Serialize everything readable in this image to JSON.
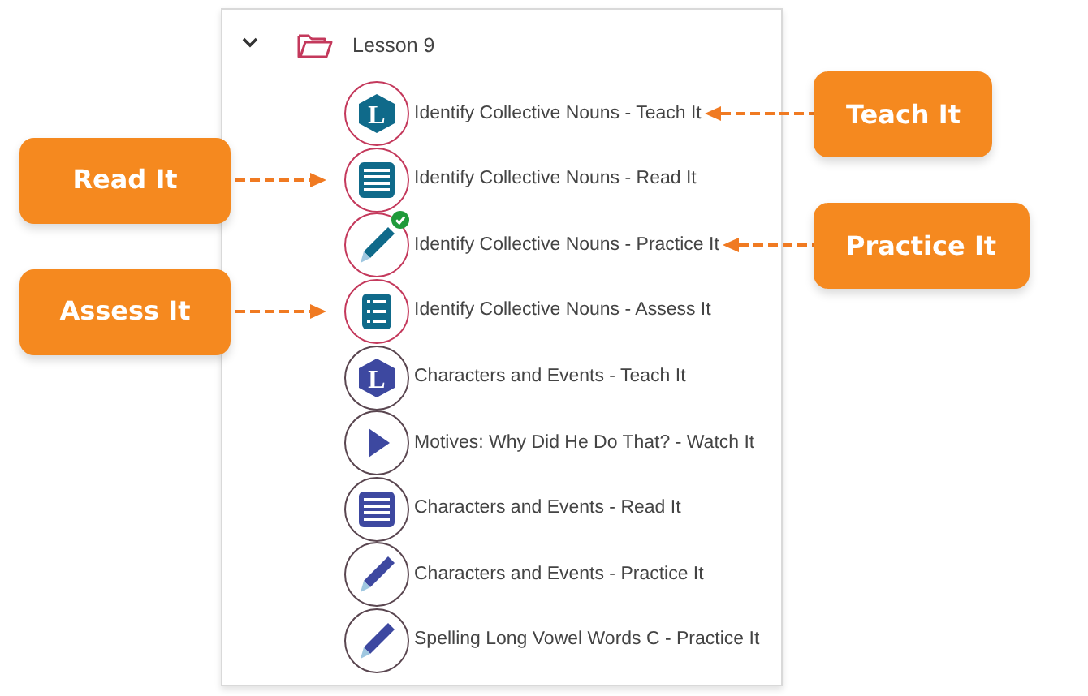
{
  "lesson": {
    "title": "Lesson 9",
    "expanded": true
  },
  "items": [
    {
      "title": "Identify Collective Nouns - Teach It",
      "kind": "teach",
      "letter": "L",
      "highlighted": true,
      "completed": false,
      "callout": {
        "label": "Teach It",
        "kind": "right"
      }
    },
    {
      "title": "Identify Collective Nouns - Read It",
      "kind": "read",
      "highlighted": true,
      "completed": false,
      "callout": {
        "label": "Read It",
        "kind": "left"
      }
    },
    {
      "title": "Identify Collective Nouns - Practice It",
      "kind": "practice",
      "highlighted": true,
      "completed": true,
      "callout": {
        "label": "Practice It",
        "kind": "right"
      }
    },
    {
      "title": "Identify Collective Nouns - Assess It",
      "kind": "assess",
      "highlighted": true,
      "completed": false,
      "callout": {
        "label": "Assess It",
        "kind": "left"
      }
    },
    {
      "title": "Characters and Events - Teach It",
      "kind": "teach",
      "letter": "L",
      "highlighted": false,
      "completed": false
    },
    {
      "title": "Motives: Why Did He Do That? - Watch It",
      "kind": "watch",
      "highlighted": false,
      "completed": false
    },
    {
      "title": "Characters and Events - Read It",
      "kind": "read",
      "highlighted": false,
      "completed": false
    },
    {
      "title": "Characters and Events - Practice It",
      "kind": "practice",
      "highlighted": false,
      "completed": false
    },
    {
      "title": "Spelling Long Vowel Words C - Practice It",
      "kind": "practice",
      "highlighted": false,
      "completed": false
    }
  ]
}
